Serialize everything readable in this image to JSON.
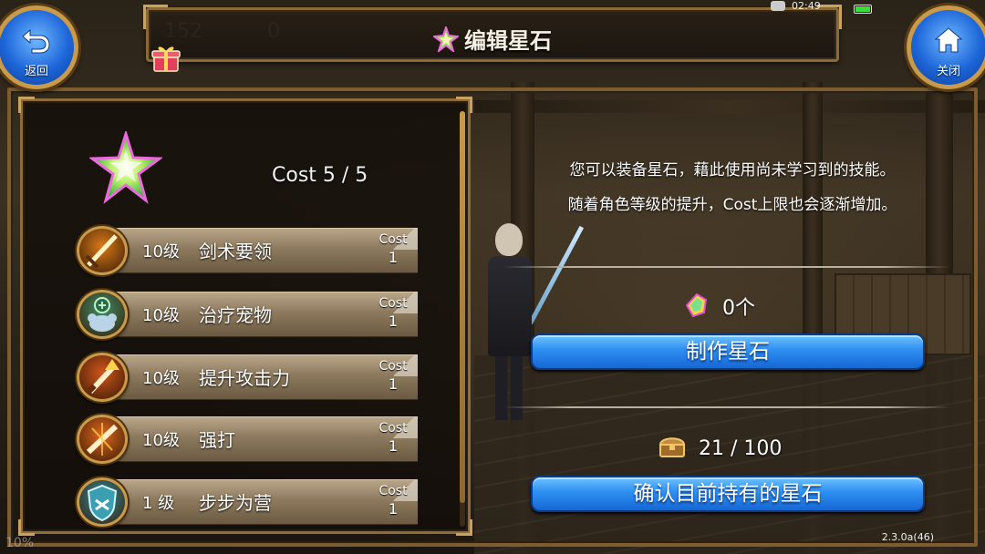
{
  "title": "编辑星石",
  "status": {
    "time": "02:49",
    "battery_color": "#3ddc3d"
  },
  "hud": {
    "stat1": "152",
    "stat2": "0",
    "bottom_stat": "10%"
  },
  "back_button": {
    "label": "返回",
    "icon": "back-arrow-icon"
  },
  "close_button": {
    "label": "关闭",
    "icon": "home-icon"
  },
  "cost_summary": "Cost 5 / 5",
  "skills": [
    {
      "level": "10级",
      "name": "剑术要领",
      "cost_label": "Cost",
      "cost": "1",
      "icon": "sword-mastery-icon",
      "color": "#d97a1a"
    },
    {
      "level": "10级",
      "name": "治疗宠物",
      "cost_label": "Cost",
      "cost": "1",
      "icon": "heal-pet-icon",
      "color": "#3e8f6a"
    },
    {
      "level": "10级",
      "name": "提升攻击力",
      "cost_label": "Cost",
      "cost": "1",
      "icon": "attack-up-icon",
      "color": "#d0541b"
    },
    {
      "level": "10级",
      "name": "强打",
      "cost_label": "Cost",
      "cost": "1",
      "icon": "power-strike-icon",
      "color": "#e0661c"
    },
    {
      "level": "1 级",
      "name": "步步为营",
      "cost_label": "Cost",
      "cost": "1",
      "icon": "steady-advance-icon",
      "color": "#2f8fa0"
    }
  ],
  "info": {
    "line1": "您可以装备星石，藉此使用尚未学习到的技能。",
    "line2": "随着角色等级的提升，Cost上限也会逐渐增加。"
  },
  "star_stock": {
    "count": "0个",
    "icon": "star-shard-icon"
  },
  "craft_button": {
    "label": "制作星石"
  },
  "storage": {
    "count": "21 / 100",
    "icon": "treasure-chest-icon"
  },
  "view_button": {
    "label": "确认目前持有的星石"
  },
  "version": "2.3.0a(46)",
  "colors": {
    "frame_gold": "#c99a4a",
    "button_blue": "#2d8ef2"
  }
}
